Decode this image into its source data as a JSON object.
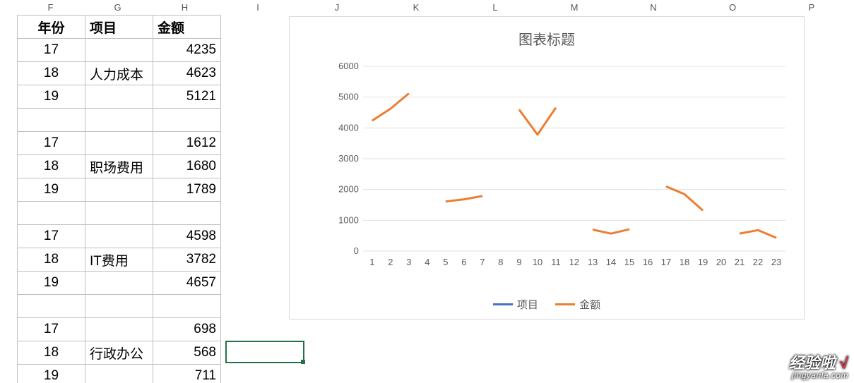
{
  "sheet": {
    "col_labels": [
      "F",
      "G",
      "H",
      "I",
      "J",
      "K",
      "L",
      "M",
      "N",
      "O",
      "P"
    ],
    "headers": {
      "F": "年份",
      "G": "项目",
      "H": "金额"
    },
    "rows": [
      {
        "F": "17",
        "G": "",
        "H": "4235"
      },
      {
        "F": "18",
        "G": "人力成本",
        "H": "4623"
      },
      {
        "F": "19",
        "G": "",
        "H": "5121"
      },
      {
        "F": "",
        "G": "",
        "H": ""
      },
      {
        "F": "17",
        "G": "",
        "H": "1612"
      },
      {
        "F": "18",
        "G": "职场费用",
        "H": "1680"
      },
      {
        "F": "19",
        "G": "",
        "H": "1789"
      },
      {
        "F": "",
        "G": "",
        "H": ""
      },
      {
        "F": "17",
        "G": "",
        "H": "4598"
      },
      {
        "F": "18",
        "G": "IT费用",
        "H": "3782"
      },
      {
        "F": "19",
        "G": "",
        "H": "4657"
      },
      {
        "F": "",
        "G": "",
        "H": ""
      },
      {
        "F": "17",
        "G": "",
        "H": "698"
      },
      {
        "F": "18",
        "G": "行政办公",
        "H": "568"
      },
      {
        "F": "19",
        "G": "",
        "H": "711"
      }
    ],
    "selected_cell": "I15"
  },
  "chart_data": {
    "type": "line",
    "title": "图表标题",
    "xlabel": "",
    "ylabel": "",
    "ylim": [
      0,
      6000
    ],
    "y_ticks": [
      0,
      1000,
      2000,
      3000,
      4000,
      5000,
      6000
    ],
    "categories": [
      "1",
      "2",
      "3",
      "4",
      "5",
      "6",
      "7",
      "8",
      "9",
      "10",
      "11",
      "12",
      "13",
      "14",
      "15",
      "16",
      "17",
      "18",
      "19",
      "20",
      "21",
      "22",
      "23"
    ],
    "series": [
      {
        "name": "项目",
        "color": "#4472C4",
        "values": [
          null,
          null,
          null,
          null,
          null,
          null,
          null,
          null,
          null,
          null,
          null,
          null,
          null,
          null,
          null,
          null,
          null,
          null,
          null,
          null,
          null,
          null,
          null
        ]
      },
      {
        "name": "金额",
        "color": "#ED7D31",
        "values": [
          4235,
          4623,
          5121,
          null,
          1612,
          1680,
          1789,
          null,
          4598,
          3782,
          4657,
          null,
          698,
          568,
          711,
          null,
          2100,
          1850,
          1320,
          null,
          570,
          680,
          430
        ]
      }
    ],
    "legend": {
      "position": "bottom"
    }
  },
  "watermark": {
    "line1_a": "经验啦",
    "line1_b": "√",
    "line2": "jingyanla.com"
  }
}
